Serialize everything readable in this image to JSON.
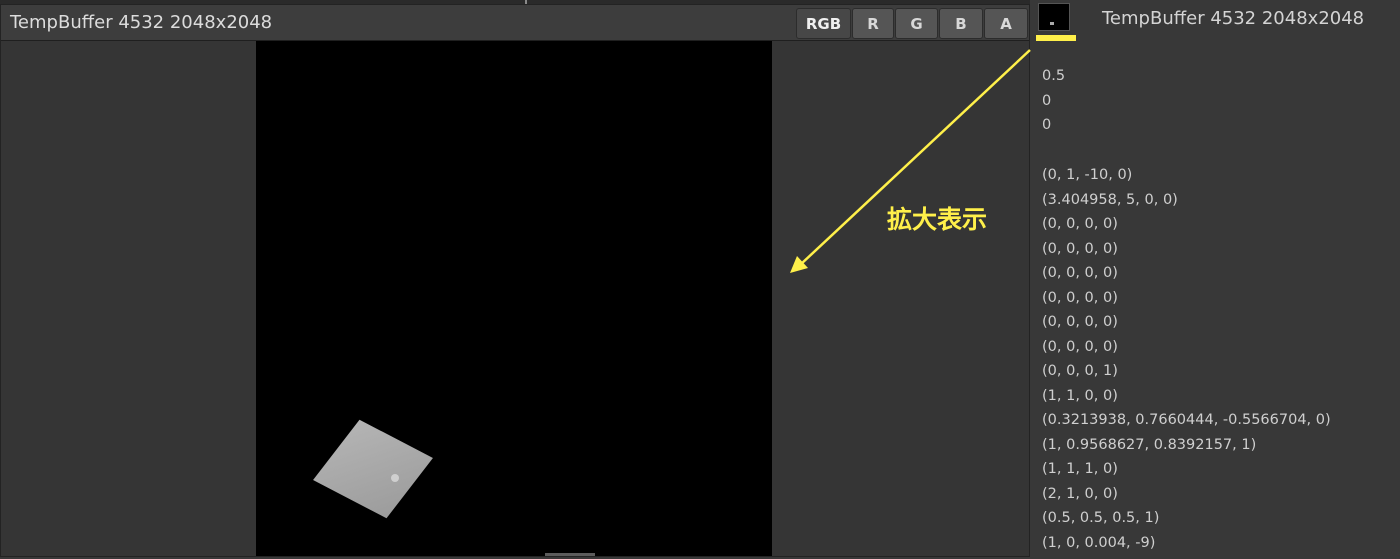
{
  "preview": {
    "title": "TempBuffer 4532 2048x2048",
    "channels": [
      "RGB",
      "R",
      "G",
      "B",
      "A"
    ],
    "active_channel": "RGB"
  },
  "sidebar": {
    "title": "TempBuffer 4532 2048x2048",
    "scalar_values": [
      "0.5",
      "0",
      "0"
    ],
    "vector_values": [
      "(0, 1, -10, 0)",
      "(3.404958, 5, 0, 0)",
      "(0, 0, 0, 0)",
      "(0, 0, 0, 0)",
      "(0, 0, 0, 0)",
      "(0, 0, 0, 0)",
      "(0, 0, 0, 0)",
      "(0, 0, 0, 0)",
      "(0, 0, 0, 1)",
      "(1, 1, 0, 0)",
      "(0.3213938, 0.7660444, -0.5566704, 0)",
      "(1, 0.9568627, 0.8392157, 1)",
      "(1, 1, 1, 0)",
      "(2, 1, 0, 0)",
      "(0.5, 0.5, 0.5, 1)",
      "(1, 0, 0.004, -9)"
    ]
  },
  "annotation": {
    "label": "拡大表示",
    "color": "#fff04a"
  }
}
